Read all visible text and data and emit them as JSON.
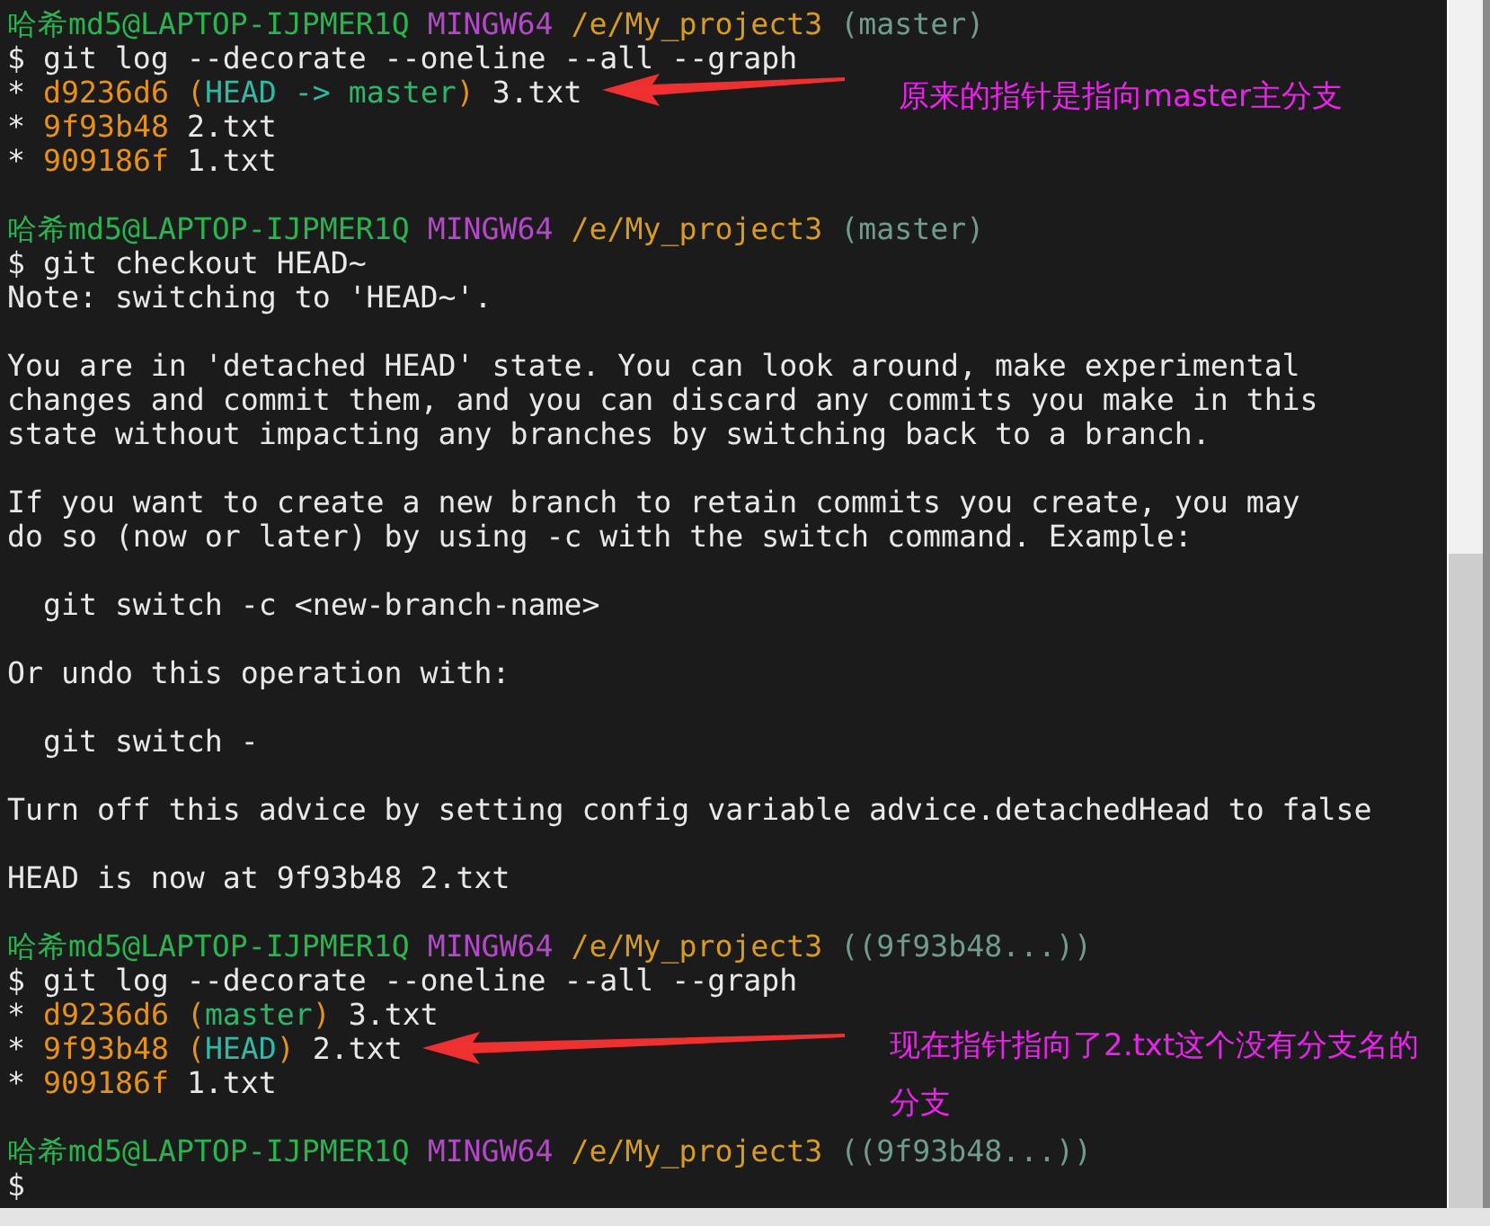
{
  "terminal": {
    "blocks": [
      [
        [
          {
            "kind": "user",
            "text": "哈希md5@LAPTOP-IJPMER1Q"
          },
          {
            "kind": "system",
            "text": "MINGW64"
          },
          {
            "kind": "path",
            "text": "/e/My_project3"
          },
          {
            "kind": "branch",
            "text": "(master)"
          }
        ],
        [
          {
            "kind": "command",
            "text": "$ git log --decorate --oneline --all --graph"
          }
        ],
        [
          {
            "kind": "graph",
            "text": "*"
          },
          {
            "kind": "hash",
            "text": "d9236d6"
          },
          {
            "kind": "refs",
            "parts": [
              {
                "kind": "paren",
                "text": "("
              },
              {
                "kind": "head",
                "text": "HEAD -> "
              },
              {
                "kind": "ref",
                "text": "master"
              },
              {
                "kind": "paren",
                "text": ")"
              }
            ]
          },
          {
            "kind": "text",
            "text": "3.txt"
          }
        ],
        [
          {
            "kind": "graph",
            "text": "*"
          },
          {
            "kind": "hash",
            "text": "9f93b48"
          },
          {
            "kind": "text",
            "text": "2.txt"
          }
        ],
        [
          {
            "kind": "graph",
            "text": "*"
          },
          {
            "kind": "hash",
            "text": "909186f"
          },
          {
            "kind": "text",
            "text": "1.txt"
          }
        ]
      ],
      [
        [
          {
            "kind": "user",
            "text": "哈希md5@LAPTOP-IJPMER1Q"
          },
          {
            "kind": "system",
            "text": "MINGW64"
          },
          {
            "kind": "path",
            "text": "/e/My_project3"
          },
          {
            "kind": "branch",
            "text": "(master)"
          }
        ],
        [
          {
            "kind": "command",
            "text": "$ git checkout HEAD~"
          }
        ],
        [
          {
            "kind": "text",
            "text": "Note: switching to 'HEAD~'."
          }
        ]
      ],
      [
        [
          {
            "kind": "text",
            "text": "You are in 'detached HEAD' state. You can look around, make experimental"
          }
        ],
        [
          {
            "kind": "text",
            "text": "changes and commit them, and you can discard any commits you make in this"
          }
        ],
        [
          {
            "kind": "text",
            "text": "state without impacting any branches by switching back to a branch."
          }
        ]
      ],
      [
        [
          {
            "kind": "text",
            "text": "If you want to create a new branch to retain commits you create, you may"
          }
        ],
        [
          {
            "kind": "text",
            "text": "do so (now or later) by using -c with the switch command. Example:"
          }
        ]
      ],
      [
        [
          {
            "kind": "text",
            "text": "  git switch -c <new-branch-name>"
          }
        ]
      ],
      [
        [
          {
            "kind": "text",
            "text": "Or undo this operation with:"
          }
        ]
      ],
      [
        [
          {
            "kind": "text",
            "text": "  git switch -"
          }
        ]
      ],
      [
        [
          {
            "kind": "text",
            "text": "Turn off this advice by setting config variable advice.detachedHead to false"
          }
        ]
      ],
      [
        [
          {
            "kind": "text",
            "text": "HEAD is now at 9f93b48 2.txt"
          }
        ]
      ],
      [
        [
          {
            "kind": "user",
            "text": "哈希md5@LAPTOP-IJPMER1Q"
          },
          {
            "kind": "system",
            "text": "MINGW64"
          },
          {
            "kind": "path",
            "text": "/e/My_project3"
          },
          {
            "kind": "branch",
            "text": "((9f93b48...))"
          }
        ],
        [
          {
            "kind": "command",
            "text": "$ git log --decorate --oneline --all --graph"
          }
        ],
        [
          {
            "kind": "graph",
            "text": "*"
          },
          {
            "kind": "hash",
            "text": "d9236d6"
          },
          {
            "kind": "refs",
            "parts": [
              {
                "kind": "paren",
                "text": "("
              },
              {
                "kind": "ref",
                "text": "master"
              },
              {
                "kind": "paren",
                "text": ")"
              }
            ]
          },
          {
            "kind": "text",
            "text": "3.txt"
          }
        ],
        [
          {
            "kind": "graph",
            "text": "*"
          },
          {
            "kind": "hash",
            "text": "9f93b48"
          },
          {
            "kind": "refs",
            "parts": [
              {
                "kind": "paren",
                "text": "("
              },
              {
                "kind": "head",
                "text": "HEAD"
              },
              {
                "kind": "paren",
                "text": ")"
              }
            ]
          },
          {
            "kind": "text",
            "text": "2.txt"
          }
        ],
        [
          {
            "kind": "graph",
            "text": "*"
          },
          {
            "kind": "hash",
            "text": "909186f"
          },
          {
            "kind": "text",
            "text": "1.txt"
          }
        ]
      ],
      [
        [
          {
            "kind": "user",
            "text": "哈希md5@LAPTOP-IJPMER1Q"
          },
          {
            "kind": "system",
            "text": "MINGW64"
          },
          {
            "kind": "path",
            "text": "/e/My_project3"
          },
          {
            "kind": "branch",
            "text": "((9f93b48...))"
          }
        ],
        [
          {
            "kind": "command",
            "text": "$"
          }
        ]
      ]
    ]
  },
  "annotations": [
    {
      "text": "原来的指针是指向master主分支"
    },
    {
      "text": "现在指针指向了2.txt这个没有分支名的分支"
    }
  ]
}
